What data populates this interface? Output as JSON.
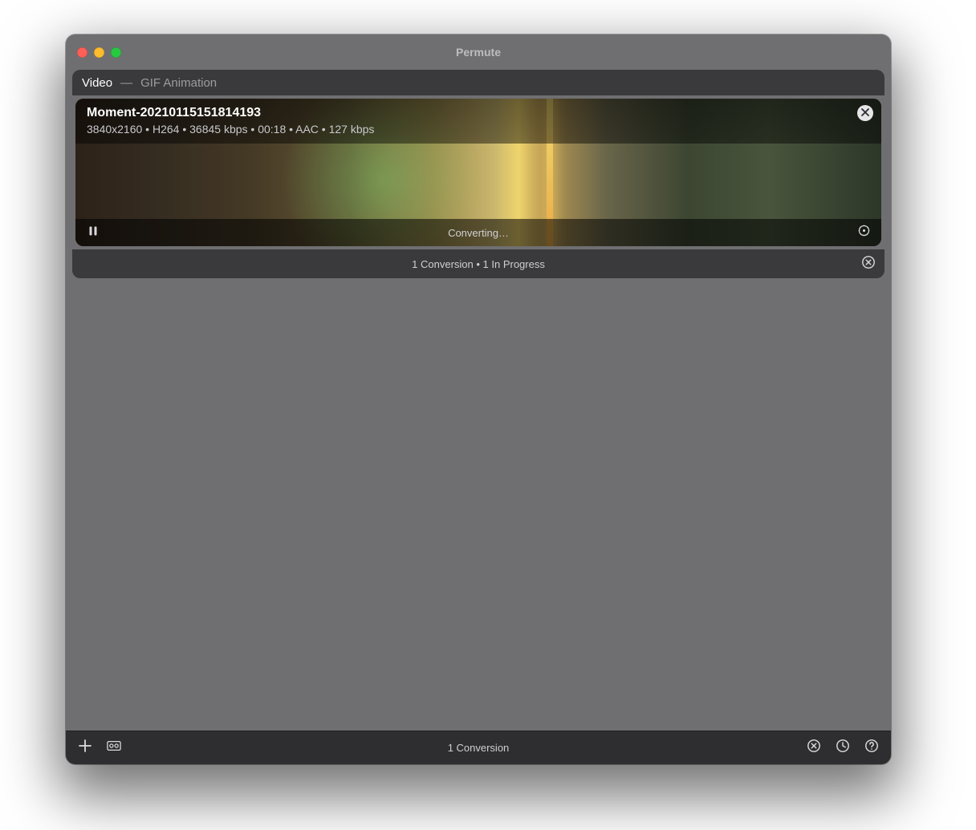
{
  "window": {
    "title": "Permute"
  },
  "group": {
    "category": "Video",
    "preset": "GIF Animation",
    "footer_text": "1 Conversion  •  1 In Progress"
  },
  "item": {
    "filename": "Moment-20210115151814193",
    "meta": "3840x2160  •  H264  •  36845 kbps  •  00:18  •  AAC  •  127 kbps",
    "status": "Converting…"
  },
  "toolbar": {
    "center_text": "1 Conversion"
  }
}
